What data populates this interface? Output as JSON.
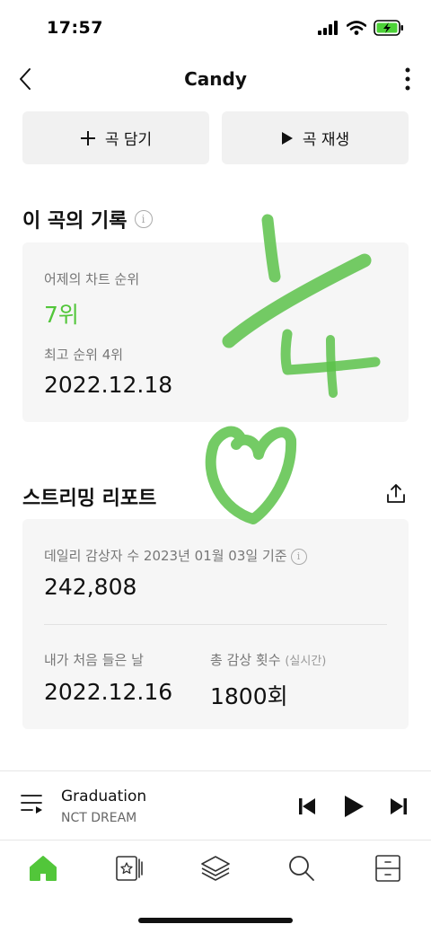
{
  "status_bar": {
    "time": "17:57"
  },
  "header": {
    "title": "Candy"
  },
  "actions": {
    "add_label": "곡 담기",
    "play_label": "곡 재생"
  },
  "record_section": {
    "title": "이 곡의 기록",
    "yesterday_label": "어제의 차트 순위",
    "yesterday_rank": "7위",
    "best_label": "최고 순위 4위",
    "best_date": "2022.12.18"
  },
  "streaming_section": {
    "title": "스트리밍 리포트",
    "daily_label": "데일리 감상자 수 2023년 01월 03일 기준",
    "daily_value": "242,808",
    "first_listen_label": "내가 처음 들은 날",
    "first_listen_date": "2022.12.16",
    "total_label": "총 감상 횟수",
    "total_sub": "(실시간)",
    "total_value": "1800회"
  },
  "player": {
    "title": "Graduation",
    "artist": "NCT DREAM"
  },
  "tabs": [
    {
      "name": "home",
      "icon": "home-icon",
      "active": true
    },
    {
      "name": "chart",
      "icon": "star-card-icon",
      "active": false
    },
    {
      "name": "library",
      "icon": "layers-icon",
      "active": false
    },
    {
      "name": "search",
      "icon": "search-icon",
      "active": false
    },
    {
      "name": "storage",
      "icon": "drawer-icon",
      "active": false
    }
  ],
  "colors": {
    "accent": "#52c63a",
    "doodle": "#5cc24a",
    "card_bg": "#f6f6f6",
    "button_bg": "#f1f1f1"
  }
}
